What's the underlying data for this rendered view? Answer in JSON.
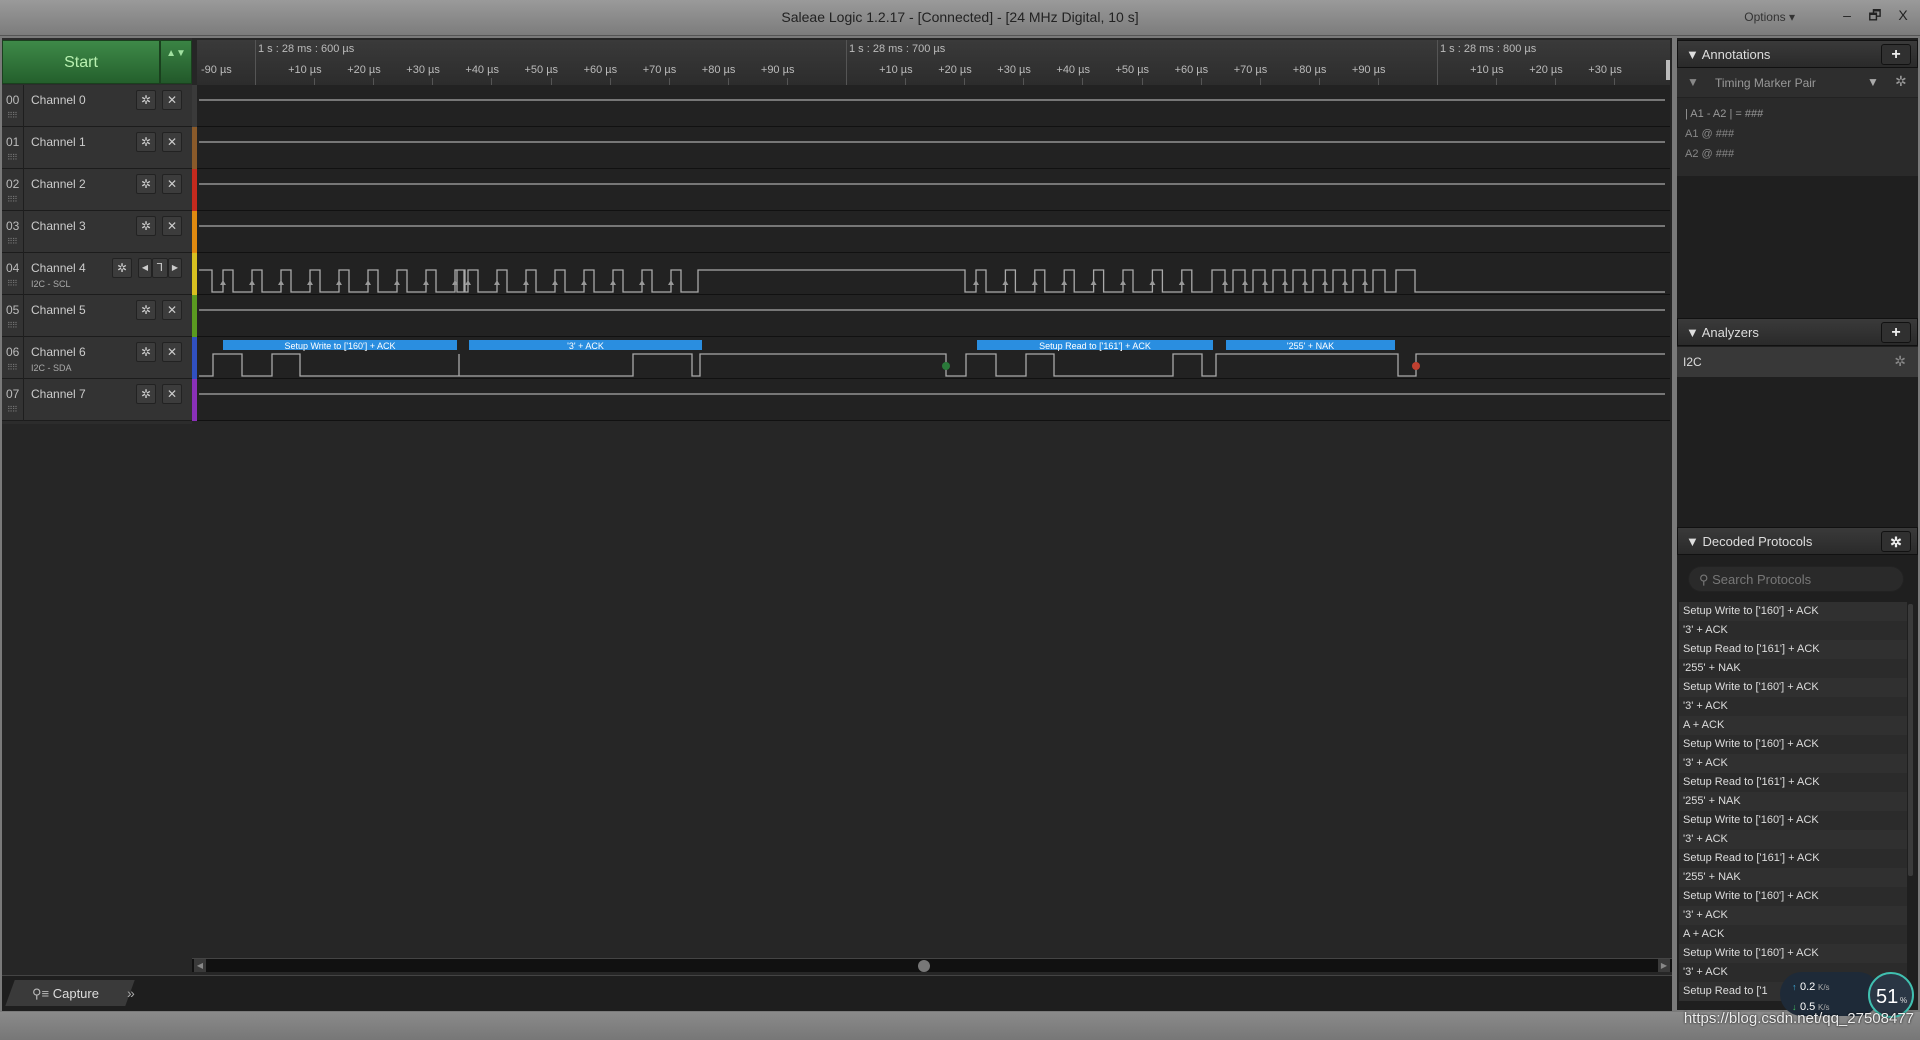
{
  "window": {
    "title": "Saleae Logic 1.2.17 - [Connected] - [24 MHz Digital, 10 s]",
    "options": "Options ▾",
    "minimize": "–",
    "restore": "🗗",
    "close": "X"
  },
  "start": {
    "label": "Start",
    "arrows": "▲▼"
  },
  "channels": [
    {
      "num": "00",
      "name": "Channel 0",
      "sub": "",
      "color": "#3a3a3a"
    },
    {
      "num": "01",
      "name": "Channel 1",
      "sub": "",
      "color": "#8a5a2a"
    },
    {
      "num": "02",
      "name": "Channel 2",
      "sub": "",
      "color": "#c42a1e"
    },
    {
      "num": "03",
      "name": "Channel 3",
      "sub": "",
      "color": "#e08a10"
    },
    {
      "num": "04",
      "name": "Channel 4",
      "sub": "I2C - SCL",
      "color": "#d8c020"
    },
    {
      "num": "05",
      "name": "Channel 5",
      "sub": "",
      "color": "#5a9a20"
    },
    {
      "num": "06",
      "name": "Channel 6",
      "sub": "I2C - SDA",
      "color": "#3050c0"
    },
    {
      "num": "07",
      "name": "Channel 7",
      "sub": "",
      "color": "#8a30b8"
    }
  ],
  "timeline": {
    "major": [
      "1 s : 28 ms : 600 µs",
      "1 s : 28 ms : 700 µs",
      "1 s : 28 ms : 800 µs"
    ],
    "lead": "-90 µs",
    "minor": [
      "+10 µs",
      "+20 µs",
      "+30 µs",
      "+40 µs",
      "+50 µs",
      "+60 µs",
      "+70 µs",
      "+80 µs",
      "+90 µs"
    ],
    "tail": [
      "+10 µs",
      "+20 µs",
      "+30 µs"
    ]
  },
  "decoded_bars": [
    "Setup Write to ['160'] + ACK",
    "'3' + ACK",
    "Setup Read to ['161'] + ACK",
    "'255' + NAK"
  ],
  "bar_color": "#2a8ee0",
  "bottom": {
    "capture": "Capture",
    "more": "»"
  },
  "annotations": {
    "title": "Annotations",
    "add": "+",
    "marker": "Timing Marker Pair",
    "line1": "| A1 - A2 | = ###",
    "a1": "A1",
    "a2": "A2",
    "a1_val": "A1  @  ###",
    "a2_val": "A2  @  ###"
  },
  "analyzers": {
    "title": "Analyzers",
    "add": "+",
    "items": [
      "I2C"
    ]
  },
  "decoded": {
    "title": "Decoded Protocols",
    "search_placeholder": "Search Protocols",
    "items": [
      "Setup Write to ['160'] + ACK",
      "'3' + ACK",
      "Setup Read to ['161'] + ACK",
      "'255' + NAK",
      "Setup Write to ['160'] + ACK",
      "'3' + ACK",
      "A + ACK",
      "Setup Write to ['160'] + ACK",
      "'3' + ACK",
      "Setup Read to ['161'] + ACK",
      "'255' + NAK",
      "Setup Write to ['160'] + ACK",
      "'3' + ACK",
      "Setup Read to ['161'] + ACK",
      "'255' + NAK",
      "Setup Write to ['160'] + ACK",
      "'3' + ACK",
      "A + ACK",
      "Setup Write to ['160'] + ACK",
      "'3' + ACK",
      "Setup Read to ['1"
    ]
  },
  "net_overlay": {
    "up": "0.2",
    "down": "0.5",
    "unit": "K/s",
    "percent": "51",
    "percent_sign": "%"
  },
  "watermark": "https://blog.csdn.net/qq_27508477"
}
